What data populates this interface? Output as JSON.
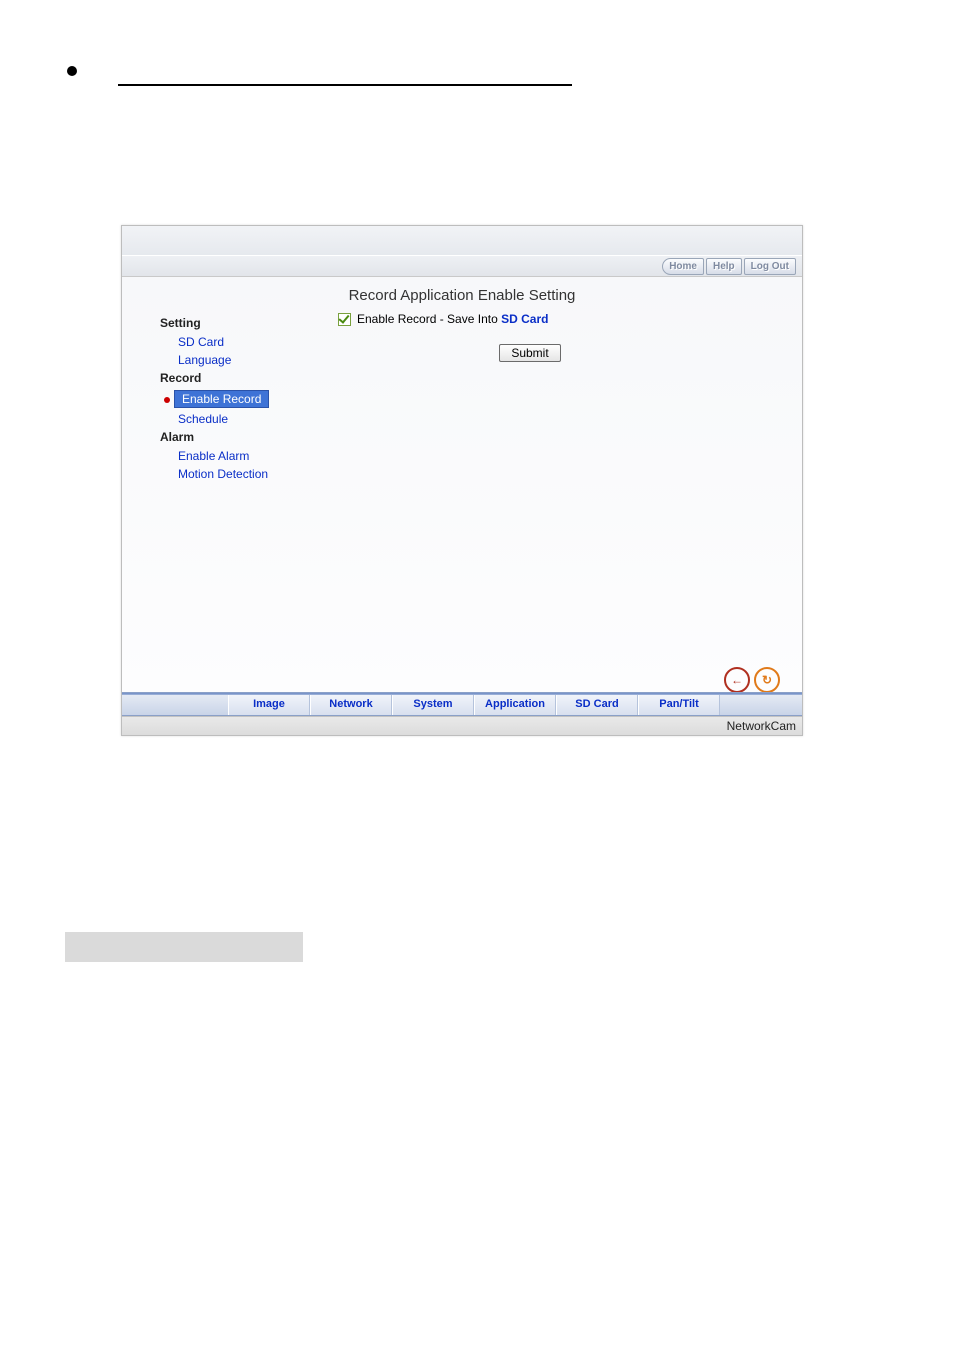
{
  "top_buttons": {
    "home": "Home",
    "help": "Help",
    "logout": "Log Out"
  },
  "page_title": "Record Application Enable Setting",
  "sidebar": {
    "groups": [
      {
        "label": "Setting",
        "items": [
          {
            "label": "SD Card",
            "active": false
          },
          {
            "label": "Language",
            "active": false
          }
        ]
      },
      {
        "label": "Record",
        "items": [
          {
            "label": "Enable Record",
            "active": true
          },
          {
            "label": "Schedule",
            "active": false
          }
        ]
      },
      {
        "label": "Alarm",
        "items": [
          {
            "label": "Enable Alarm",
            "active": false
          },
          {
            "label": "Motion Detection",
            "active": false
          }
        ]
      }
    ]
  },
  "form": {
    "checkbox_label_pre": "Enable Record - Save Into ",
    "checkbox_link": "SD Card",
    "checked": true,
    "submit_label": "Submit"
  },
  "bottom_tabs": [
    "Image",
    "Network",
    "System",
    "Application",
    "SD Card",
    "Pan/Tilt"
  ],
  "footer_brand": "NetworkCam",
  "icons": {
    "back_glyph": "←",
    "reload_glyph": "↻"
  }
}
